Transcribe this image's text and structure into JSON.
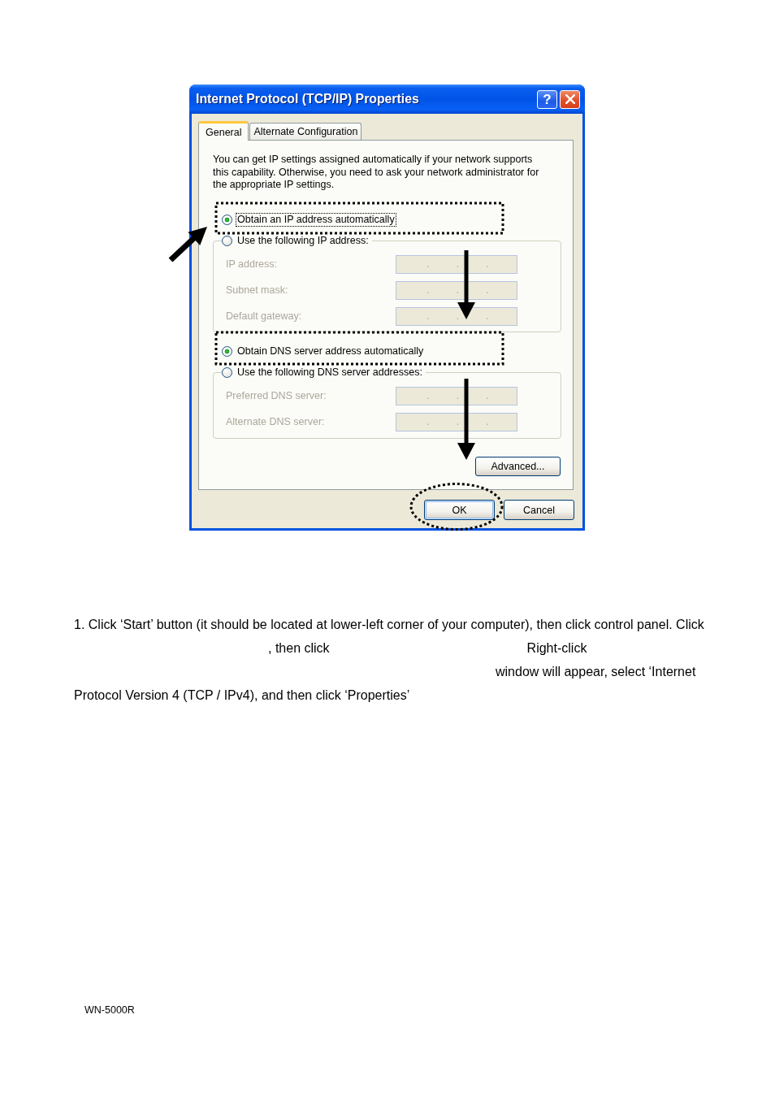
{
  "dialog": {
    "title": "Internet Protocol (TCP/IP) Properties",
    "help_button": "?",
    "tabs": [
      {
        "label": "General",
        "selected": true
      },
      {
        "label": "Alternate Configuration",
        "selected": false
      }
    ],
    "description": "You can get IP settings assigned automatically if your network supports this capability. Otherwise, you need to ask your network administrator for the appropriate IP settings.",
    "ip_settings": {
      "options": [
        {
          "label": "Obtain an IP address automatically",
          "selected": true,
          "focused": true
        },
        {
          "label": "Use the following IP address:",
          "selected": false,
          "focused": false
        }
      ],
      "fields": [
        {
          "label": "IP address:",
          "value": ". . .",
          "disabled": true
        },
        {
          "label": "Subnet mask:",
          "value": ". . .",
          "disabled": true
        },
        {
          "label": "Default gateway:",
          "value": ". . .",
          "disabled": true
        }
      ]
    },
    "dns_settings": {
      "options": [
        {
          "label": "Obtain DNS server address automatically",
          "selected": true,
          "focused": false
        },
        {
          "label": "Use the following DNS server addresses:",
          "selected": false,
          "focused": false
        }
      ],
      "fields": [
        {
          "label": "Preferred DNS server:",
          "value": ". . .",
          "disabled": true
        },
        {
          "label": "Alternate DNS server:",
          "value": ". . .",
          "disabled": true
        }
      ]
    },
    "advanced_button": {
      "label": "Advanced..."
    },
    "buttons": [
      {
        "label": "OK",
        "default": true
      },
      {
        "label": "Cancel",
        "default": false
      }
    ]
  },
  "instructions": {
    "lines": [
      [
        "1. Click ‘Start’ button (it should be located at lower-left corner of your computer), then click control panel. Click"
      ],
      [
        ", then click",
        "Right-click"
      ],
      [
        "window will appear, select ‘Internet"
      ],
      [
        "Protocol Version 4 (TCP / IPv4), and then click ‘Properties’"
      ]
    ]
  },
  "footer": "WN-5000R"
}
